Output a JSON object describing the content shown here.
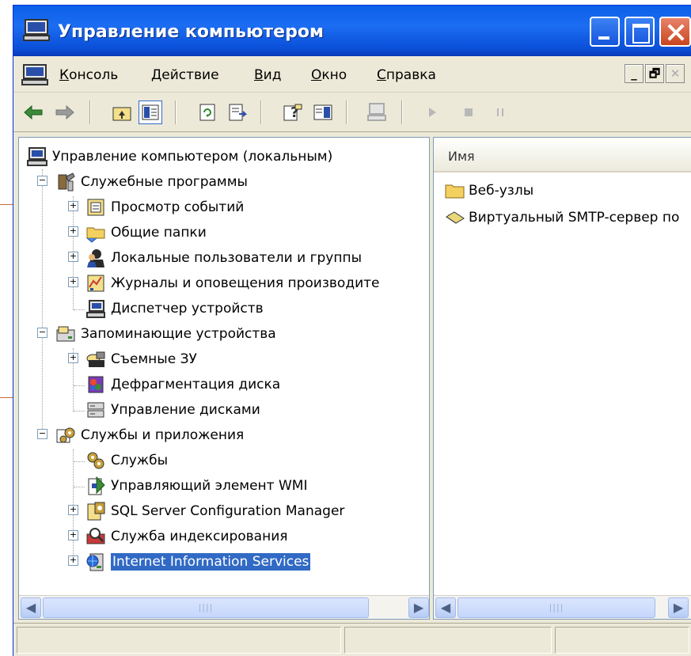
{
  "window": {
    "title": "Управление компьютером"
  },
  "menu": [
    "Консоль",
    "Действие",
    "Вид",
    "Окно",
    "Справка"
  ],
  "mdi_buttons": [
    "_",
    "🗗",
    "✕"
  ],
  "toolbar_icons": [
    "back-arrow-icon",
    "forward-arrow-icon",
    "up-folder-icon",
    "show-hide-tree-icon",
    "refresh-icon",
    "export-list-icon",
    "help-icon",
    "action-pane-icon",
    "connect-computer-icon",
    "play-icon",
    "stop-icon",
    "pause-icon"
  ],
  "tree": {
    "root": "Управление компьютером (локальным)",
    "items": [
      {
        "label": "Служебные программы",
        "level": 1,
        "icon": "tools-icon",
        "expander": "−"
      },
      {
        "label": "Просмотр событий",
        "level": 2,
        "icon": "event-viewer-icon",
        "expander": "+"
      },
      {
        "label": "Общие папки",
        "level": 2,
        "icon": "shared-folders-icon",
        "expander": "+"
      },
      {
        "label": "Локальные пользователи и группы",
        "level": 2,
        "icon": "users-icon",
        "expander": "+"
      },
      {
        "label": "Журналы и оповещения производите",
        "level": 2,
        "icon": "performance-logs-icon",
        "expander": "+"
      },
      {
        "label": "Диспетчер устройств",
        "level": 2,
        "icon": "device-manager-icon",
        "expander": ""
      },
      {
        "label": "Запоминающие устройства",
        "level": 1,
        "icon": "storage-icon",
        "expander": "−"
      },
      {
        "label": "Съемные ЗУ",
        "level": 2,
        "icon": "removable-storage-icon",
        "expander": "+"
      },
      {
        "label": "Дефрагментация диска",
        "level": 2,
        "icon": "defrag-icon",
        "expander": ""
      },
      {
        "label": "Управление дисками",
        "level": 2,
        "icon": "disk-management-icon",
        "expander": ""
      },
      {
        "label": "Службы и приложения",
        "level": 1,
        "icon": "services-apps-icon",
        "expander": "−"
      },
      {
        "label": "Службы",
        "level": 2,
        "icon": "services-icon",
        "expander": ""
      },
      {
        "label": "Управляющий элемент WMI",
        "level": 2,
        "icon": "wmi-icon",
        "expander": ""
      },
      {
        "label": "SQL Server Configuration Manager",
        "level": 2,
        "icon": "sql-config-icon",
        "expander": "+"
      },
      {
        "label": "Служба индексирования",
        "level": 2,
        "icon": "indexing-icon",
        "expander": "+"
      },
      {
        "label": "Internet Information Services",
        "level": 2,
        "icon": "iis-icon",
        "expander": "+",
        "selected": true
      }
    ]
  },
  "list": {
    "column": "Имя",
    "items": [
      {
        "label": "Веб-узлы",
        "icon": "folder-icon"
      },
      {
        "label": "Виртуальный SMTP-сервер по",
        "icon": "smtp-server-icon"
      }
    ]
  },
  "colors": {
    "titlebar": "#0a5fe8",
    "selection": "#316ac5",
    "chrome": "#ece9d8"
  }
}
